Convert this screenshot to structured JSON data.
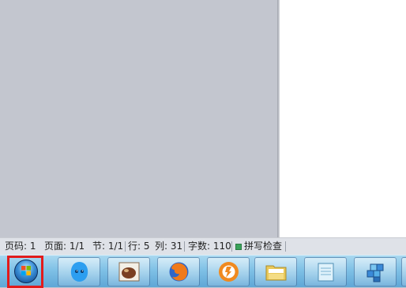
{
  "statusbar": {
    "pages_label": "页码: 1",
    "page_label": "页面: 1/1",
    "section_label": "节: 1/1",
    "row_label": "行: 5",
    "col_label": "列: 31",
    "wordcount_label": "字数: 110",
    "spellcheck_label": "拼写检查"
  },
  "taskbar": {
    "items": [
      {
        "icon": "start-orb-icon"
      },
      {
        "icon": "qq-penguin-icon"
      },
      {
        "icon": "coffee-cup-icon"
      },
      {
        "icon": "firefox-icon"
      },
      {
        "icon": "thunder-download-icon"
      },
      {
        "icon": "folder-icon"
      },
      {
        "icon": "notepad-icon"
      },
      {
        "icon": "registry-cubes-icon"
      }
    ]
  },
  "colors": {
    "highlight_border": "#e21b1b",
    "taskbar_top": "#a9d8f0",
    "taskbar_bottom": "#5fa6d6"
  }
}
